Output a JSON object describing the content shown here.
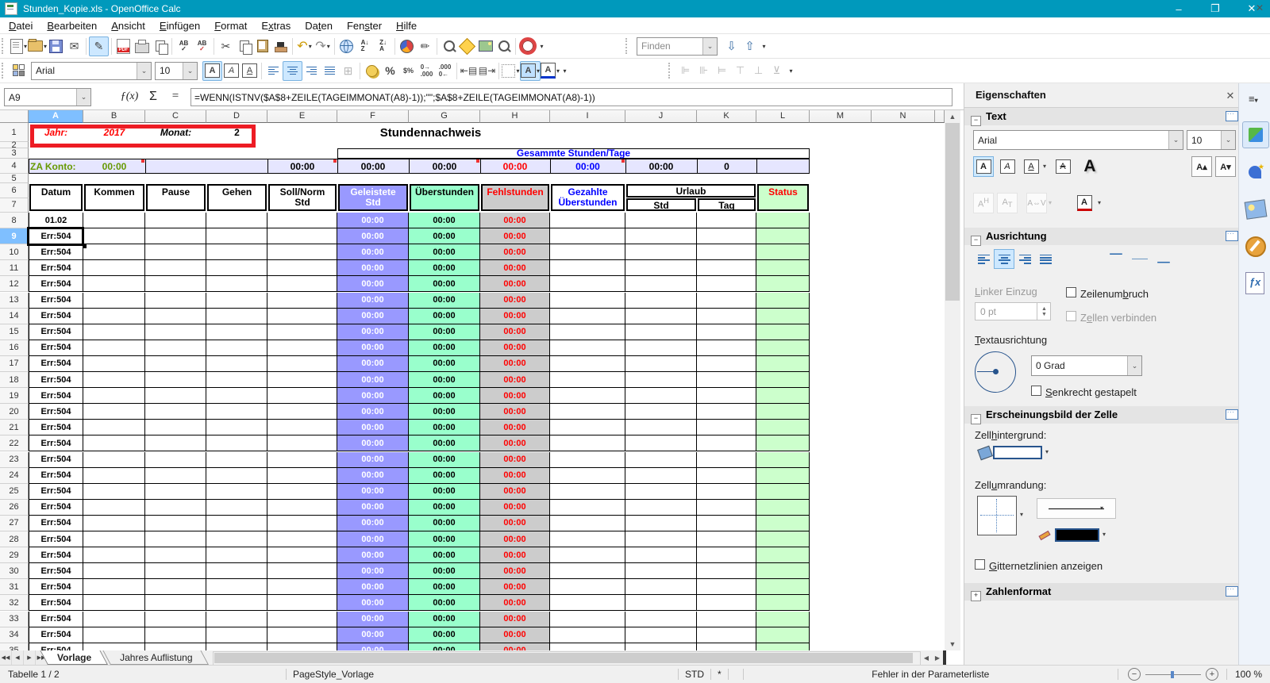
{
  "window": {
    "title": "Stunden_Kopie.xls - OpenOffice Calc",
    "minimize": "–",
    "restore": "❐",
    "close": "✕"
  },
  "menubar": {
    "items": [
      {
        "label": "Datei",
        "u": 0
      },
      {
        "label": "Bearbeiten",
        "u": 0
      },
      {
        "label": "Ansicht",
        "u": 0
      },
      {
        "label": "Einfügen",
        "u": 0
      },
      {
        "label": "Format",
        "u": 0
      },
      {
        "label": "Extras",
        "u": 1
      },
      {
        "label": "Daten",
        "u": 2
      },
      {
        "label": "Fenster",
        "u": 3
      },
      {
        "label": "Hilfe",
        "u": 0
      }
    ]
  },
  "toolbar1": {
    "find_placeholder": "Finden"
  },
  "toolbar2": {
    "font_name": "Arial",
    "font_size": "10"
  },
  "formula_bar": {
    "cell_ref": "A9",
    "fx": "ƒ(x)",
    "sum": "Σ",
    "equals": "=",
    "formula": "=WENN(ISTNV($A$8+ZEILE(TAGEIMMONAT(A8)-1));\"\";$A$8+ZEILE(TAGEIMMONAT(A8)-1))"
  },
  "sheet": {
    "columns": [
      "A",
      "B",
      "C",
      "D",
      "E",
      "F",
      "G",
      "H",
      "I",
      "J",
      "K",
      "L",
      "M",
      "N"
    ],
    "selected_cell": "A9",
    "row1": {
      "jahr_label": "Jahr:",
      "jahr_value": "2017",
      "monat_label": "Monat:",
      "monat_value": "2"
    },
    "title": "Stundennachweis",
    "summary_label": "Gesammte Stunden/Tage",
    "za_konto_label": "ZA Konto:",
    "za_konto_value": "00:00",
    "row4_values": {
      "E": "00:00",
      "F": "00:00",
      "G": "00:00",
      "H": "00:00",
      "I": "00:00",
      "J": "00:00",
      "K": "0"
    },
    "table_headers": {
      "datum": "Datum",
      "kommen": "Kommen",
      "pause": "Pause",
      "gehen": "Gehen",
      "soll": "Soll/Norm Std",
      "geleistete": "Geleistete Std",
      "ueberstunden": "Überstunden",
      "fehlstunden": "Fehlstunden",
      "gezahlte": "Gezahlte Überstunden",
      "urlaub": "Urlaub",
      "urlaub_std": "Std",
      "urlaub_tag": "Tag",
      "status": "Status"
    },
    "first_date": "01.02",
    "error_value": "Err:504",
    "time_zero": "00:00",
    "first_data_row": 8,
    "last_data_row": 35
  },
  "tabs": {
    "items": [
      "Vorlage",
      "Jahres Auflistung"
    ],
    "active": "Vorlage"
  },
  "statusbar": {
    "sheet_info": "Tabelle 1 / 2",
    "page_style": "PageStyle_Vorlage",
    "mode": "STD",
    "modified": "*",
    "message": "Fehler in der Parameterliste",
    "zoom_value": "100 %"
  },
  "sidebar": {
    "title": "Eigenschaften",
    "sections": {
      "text": "Text",
      "ausrichtung": "Ausrichtung",
      "erscheinung": "Erscheinungsbild der Zelle",
      "zahlenformat": "Zahlenformat"
    },
    "font_name": "Arial",
    "font_size": "10",
    "linker_einzug": {
      "label": "Linker Einzug",
      "u": 0,
      "value": "0 pt"
    },
    "zeilenumbruch": {
      "label": "Zeilenumbruch",
      "u": 8
    },
    "zellen_verbinden": {
      "label": "Zellen verbinden",
      "u": 1
    },
    "textausrichtung": {
      "label": "Textausrichtung",
      "u": 0
    },
    "grad_value": "0 Grad",
    "senkrecht": {
      "label": "Senkrecht gestapelt",
      "u": 0
    },
    "zellhintergrund": {
      "label": "Zellhintergrund:",
      "u": 4
    },
    "zellumrandung": {
      "label": "Zellumrandung:",
      "u": 4
    },
    "gitternetz": {
      "label": "Gitternetzlinien anzeigen",
      "u": 0
    }
  },
  "colors": {
    "titlebar": "#0099bc",
    "col_f_bg": "#9999ff",
    "col_g_bg": "#99ffcc",
    "col_h_bg": "#cccccc",
    "col_l_bg": "#ccffcc",
    "row4_bg": "#e6e6ff",
    "header_sel": "#7fbfff",
    "red_text": "#ff0000",
    "blue_text": "#0000ff",
    "green_text": "#669900",
    "annotation": "#ed1c24"
  }
}
